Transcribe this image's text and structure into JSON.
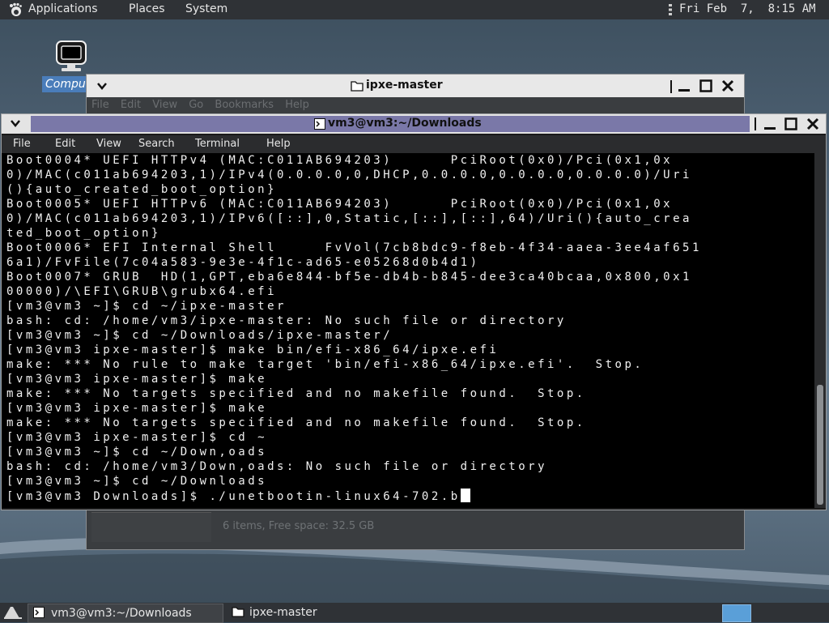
{
  "top_panel": {
    "menus": [
      "Applications",
      "Places",
      "System"
    ],
    "clock": "Fri Feb  7,  8:15 AM"
  },
  "desktop": {
    "computer_icon_label": "Computer"
  },
  "file_manager": {
    "title": "ipxe-master",
    "menu": [
      "File",
      "Edit",
      "View",
      "Go",
      "Bookmarks",
      "Help"
    ],
    "status": "6 items, Free space: 32.5 GB"
  },
  "terminal": {
    "title": "vm3@vm3:~/Downloads",
    "menu": [
      "File",
      "Edit",
      "View",
      "Search",
      "Terminal",
      "Help"
    ],
    "lines": [
      "Boot0004* UEFI HTTPv4 (MAC:C011AB694203)      PciRoot(0x0)/Pci(0x1,0x",
      "0)/MAC(c011ab694203,1)/IPv4(0.0.0.0,0,DHCP,0.0.0.0,0.0.0.0,0.0.0.0)/Uri",
      "(){auto_created_boot_option}",
      "Boot0005* UEFI HTTPv6 (MAC:C011AB694203)      PciRoot(0x0)/Pci(0x1,0x",
      "0)/MAC(c011ab694203,1)/IPv6([::],0,Static,[::],[::],64)/Uri(){auto_crea",
      "ted_boot_option}",
      "Boot0006* EFI Internal Shell     FvVol(7cb8bdc9-f8eb-4f34-aaea-3ee4af651",
      "6a1)/FvFile(7c04a583-9e3e-4f1c-ad65-e05268d0b4d1)",
      "Boot0007* GRUB  HD(1,GPT,eba6e844-bf5e-db4b-b845-dee3ca40bcaa,0x800,0x1",
      "00000)/\\EFI\\GRUB\\grubx64.efi",
      "[vm3@vm3 ~]$ cd ~/ipxe-master",
      "bash: cd: /home/vm3/ipxe-master: No such file or directory",
      "[vm3@vm3 ~]$ cd ~/Downloads/ipxe-master/",
      "[vm3@vm3 ipxe-master]$ make bin/efi-x86_64/ipxe.efi",
      "make: *** No rule to make target 'bin/efi-x86_64/ipxe.efi'.  Stop.",
      "[vm3@vm3 ipxe-master]$ make",
      "make: *** No targets specified and no makefile found.  Stop.",
      "[vm3@vm3 ipxe-master]$ make",
      "make: *** No targets specified and no makefile found.  Stop.",
      "[vm3@vm3 ipxe-master]$ cd ~",
      "[vm3@vm3 ~]$ cd ~/Down,oads",
      "bash: cd: /home/vm3/Down,oads: No such file or directory",
      "[vm3@vm3 ~]$ cd ~/Downloads"
    ],
    "prompt_line": "[vm3@vm3 Downloads]$ ./unetbootin-linux64-702.b"
  },
  "taskbar": {
    "tasks": [
      {
        "label": "vm3@vm3:~/Downloads",
        "icon": "terminal-icon"
      },
      {
        "label": "ipxe-master",
        "icon": "folder-icon"
      }
    ]
  },
  "colors": {
    "panel": "#2f3236",
    "terminal_title_band": "#7a78a8",
    "terminal_bg": "#000000",
    "terminal_fg": "#f0f0f0",
    "selected_blue": "#4a7dba"
  }
}
